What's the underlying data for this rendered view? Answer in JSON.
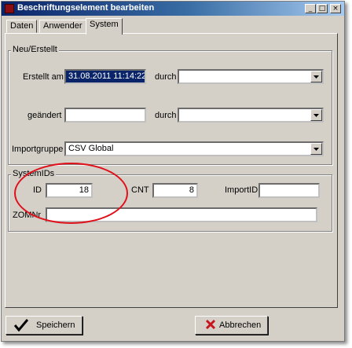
{
  "window": {
    "title": "Beschriftungselement bearbeiten",
    "controls": [
      "_",
      "□",
      "×"
    ]
  },
  "tabs": [
    "Daten",
    "Anwender",
    "System"
  ],
  "active_tab": "System",
  "neu_erstellt": {
    "title": "Neu/Erstellt",
    "erstellt_am_label": "Erstellt am",
    "erstellt_am_value": "31.08.2011 11:14:22",
    "durch_label": "durch",
    "durch1_value": "",
    "geaendert_label": "geändert",
    "geaendert_value": "",
    "durch2_value": "",
    "importgruppe_label": "Importgruppe",
    "importgruppe_value": "CSV Global"
  },
  "systemids": {
    "title": "SystemIDs",
    "id_label": "ID",
    "id_value": "18",
    "cnt_label": "CNT",
    "cnt_value": "8",
    "importid_label": "ImportID",
    "importid_value": "",
    "zomnr_label": "ZOMNr",
    "zomnr_value": ""
  },
  "buttons": {
    "save": "Speichern",
    "cancel": "Abbrechen"
  },
  "colors": {
    "annotation_circle": "#e0101a",
    "titlebar": "#0a246a",
    "save_icon": "#000000",
    "cancel_icon": "#c8141c"
  }
}
